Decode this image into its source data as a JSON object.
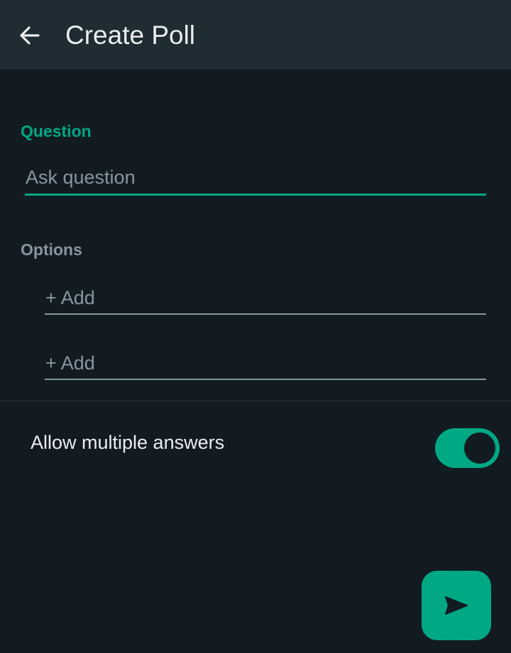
{
  "header": {
    "title": "Create Poll",
    "back_icon": "arrow-back-icon"
  },
  "question": {
    "label": "Question",
    "placeholder": "Ask question",
    "value": ""
  },
  "options": {
    "label": "Options",
    "items": [
      {
        "placeholder": "+ Add",
        "value": ""
      },
      {
        "placeholder": "+ Add",
        "value": ""
      }
    ]
  },
  "settings": {
    "allow_multiple_label": "Allow multiple answers",
    "allow_multiple_enabled": true
  },
  "send_button": {
    "icon": "send-icon"
  },
  "colors": {
    "background": "#121b22",
    "app_bar": "#1f2c34",
    "accent": "#00a884",
    "text_primary": "#e9edef",
    "text_secondary": "#8696a0"
  }
}
